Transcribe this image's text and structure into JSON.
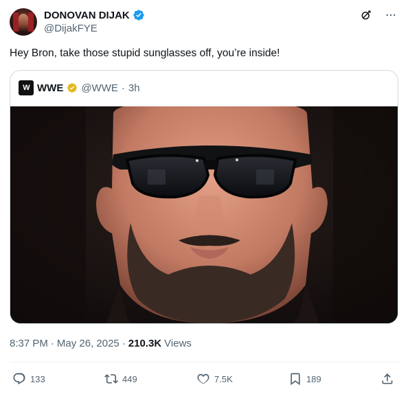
{
  "author": {
    "name": "DONOVAN DIJAK",
    "handle": "@DijakFYE",
    "verified": true
  },
  "tweet": {
    "text": "Hey Bron, take those stupid sunglasses off, you’re inside!"
  },
  "quote": {
    "logo_text": "W",
    "name": "WWE",
    "handle": "@WWE",
    "separator": "·",
    "time": "3h",
    "verified_color": "#e2b719"
  },
  "meta": {
    "time": "8:37 PM",
    "sep1": "·",
    "date": "May 26, 2025",
    "sep2": "·",
    "views_count": "210.3K",
    "views_label": "Views"
  },
  "actions": {
    "replies": "133",
    "reposts": "449",
    "likes": "7.5K",
    "bookmarks": "189"
  },
  "colors": {
    "text": "#0f1419",
    "secondary": "#536471",
    "verified_blue": "#1d9bf0",
    "border": "#cfd9de"
  },
  "icons": [
    "verified-badge-icon",
    "grok-icon",
    "more-icon",
    "reply-icon",
    "repost-icon",
    "like-icon",
    "bookmark-icon",
    "share-icon"
  ]
}
